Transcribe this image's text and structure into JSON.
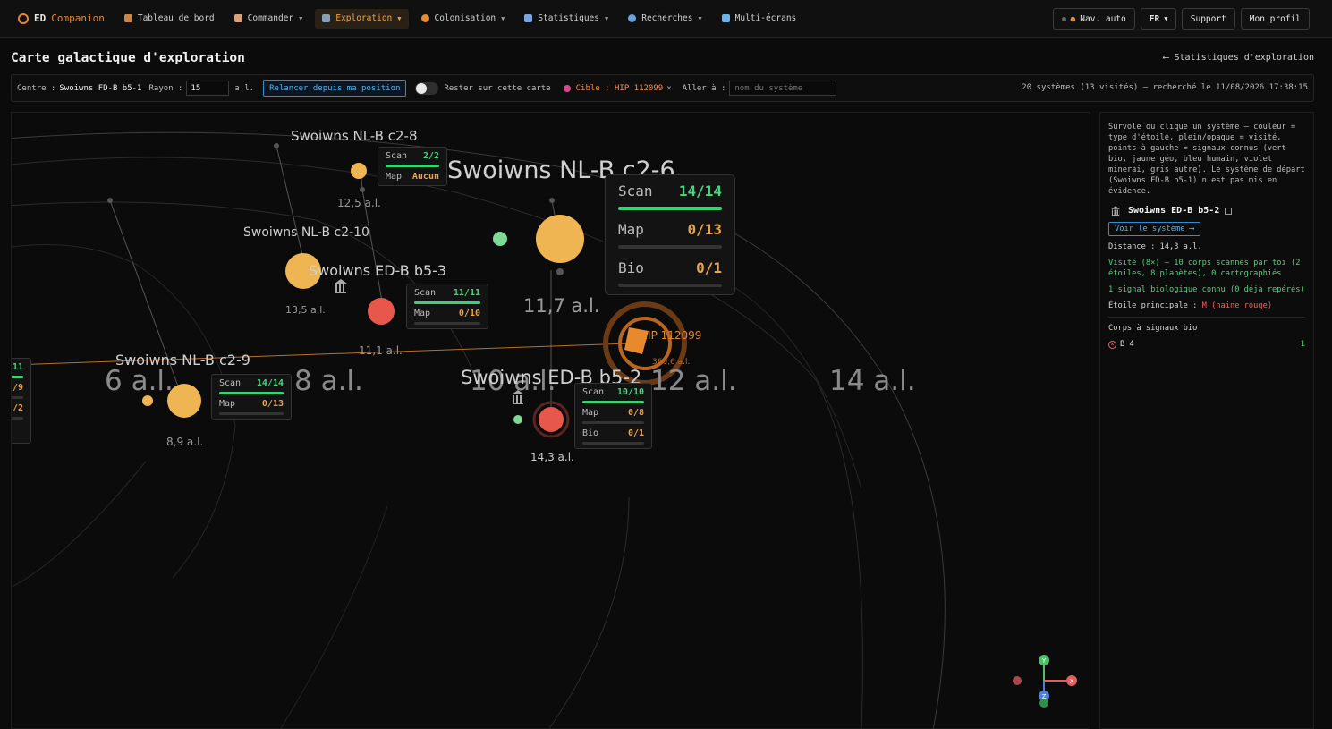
{
  "nav": {
    "brand_ed": "ED",
    "brand_companion": "Companion",
    "items": [
      {
        "label": "Tableau de bord",
        "icon": "dashboard-icon",
        "color": "#d9a15a"
      },
      {
        "label": "Commander",
        "icon": "commander-icon",
        "color": "#e0b090"
      },
      {
        "label": "Exploration",
        "icon": "telescope-icon",
        "color": "#f0a540"
      },
      {
        "label": "Colonisation",
        "icon": "planet-icon",
        "color": "#e8892b"
      },
      {
        "label": "Statistiques",
        "icon": "stats-icon",
        "color": "#7aa6e0"
      },
      {
        "label": "Recherches",
        "icon": "search-icon",
        "color": "#6fa0d8"
      },
      {
        "label": "Multi-écrans",
        "icon": "monitor-icon",
        "color": "#6fb4e8"
      }
    ],
    "nav_auto": "Nav. auto",
    "lang": "FR",
    "support": "Support",
    "profile": "Mon profil"
  },
  "page": {
    "title": "Carte galactique d'exploration",
    "back_link": "⟵ Statistiques d'exploration"
  },
  "controls": {
    "centre_label": "Centre :",
    "centre_value": "Swoiwns FD-B b5-1",
    "rayon_label": "Rayon :",
    "rayon_value": "15",
    "rayon_unit": "a.l.",
    "relaunch": "Relancer depuis ma position",
    "stay": "Rester sur cette carte",
    "target_label": "Cible :",
    "target_value": "HIP 112099",
    "goto_label": "Aller à :",
    "goto_placeholder": "nom du système",
    "summary": "20 systèmes (13 visités) — recherché le 11/08/2026 17:38:15"
  },
  "map": {
    "ring_labels": [
      "6 a.l.",
      "8 a.l.",
      "10 a.l.",
      "12 a.l.",
      "14 a.l."
    ],
    "systems": [
      {
        "name": "Swoiwns NL-B c2-8",
        "distance": "12,5 a.l.",
        "scan": "2/2",
        "map": "Aucun"
      },
      {
        "name": "Swoiwns NL-B c2-6",
        "distance": "11,7 a.l.",
        "scan": "14/14",
        "map": "0/13",
        "bio": "0/1"
      },
      {
        "name": "Swoiwns NL-B c2-10",
        "distance": "13,5 a.l."
      },
      {
        "name": "Swoiwns ED-B b5-3",
        "distance": "11,1 a.l.",
        "scan": "11/11",
        "map": "0/10"
      },
      {
        "name": "Swoiwns NL-B c2-9",
        "distance": "8,9 a.l.",
        "scan": "14/14",
        "map": "0/13"
      },
      {
        "name": "Swoiwns ED-B b5-2",
        "distance": "14,3 a.l.",
        "scan": "10/10",
        "map": "0/8",
        "bio": "0/1"
      },
      {
        "name": "HIP 112099",
        "distance": "360,6 a.l."
      }
    ],
    "clipped_card": {
      "scan": "11",
      "map": "/9",
      "bio": "/2"
    },
    "labels": {
      "scan": "Scan",
      "map": "Map",
      "bio": "Bio"
    },
    "axes": {
      "x": "X",
      "y": "Y",
      "z": "Z"
    }
  },
  "panel": {
    "help": "Survole ou clique un système — couleur = type d'étoile, plein/opaque = visité, points à gauche = signaux connus (vert bio, jaune géo, bleu humain, violet minerai, gris autre). Le système de départ (Swoiwns FD-B b5-1) n'est pas mis en évidence.",
    "system": "Swoiwns ED-B b5-2",
    "voir": "Voir le système ⟶",
    "distance": "Distance : 14,3 a.l.",
    "visited": "Visité (8×) — 10 corps scannés par toi (2 étoiles, 8 planètes), 0 cartographiés",
    "bio_signal": "1 signal biologique connu (0 déjà repérés)",
    "star_label": "Étoile principale :",
    "star_value": "M (naine rouge)",
    "bodies_title": "Corps à signaux bio",
    "body_name": "B 4",
    "body_count": "1"
  }
}
